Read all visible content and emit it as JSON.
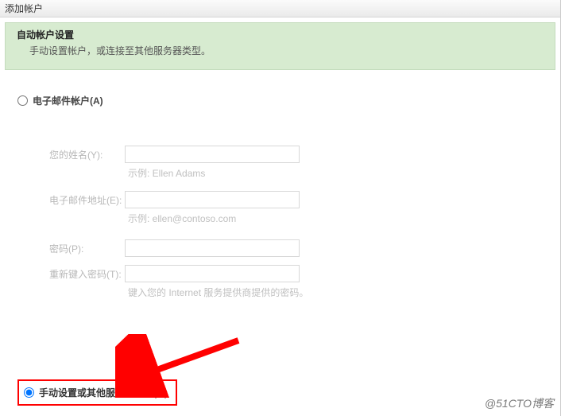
{
  "titlebar": "添加帐户",
  "banner": {
    "title": "自动帐户设置",
    "subtitle": "手动设置帐户，或连接至其他服务器类型。"
  },
  "radio_email": {
    "label": "电子邮件帐户(A)"
  },
  "form": {
    "name_label": "您的姓名(Y):",
    "name_example": "示例: Ellen Adams",
    "email_label": "电子邮件地址(E):",
    "email_example": "示例: ellen@contoso.com",
    "password_label": "密码(P):",
    "retype_label": "重新键入密码(T):",
    "password_hint": "键入您的 Internet 服务提供商提供的密码。"
  },
  "radio_manual": {
    "label": "手动设置或其他服务器类型(M)"
  },
  "watermark": "@51CTO博客"
}
